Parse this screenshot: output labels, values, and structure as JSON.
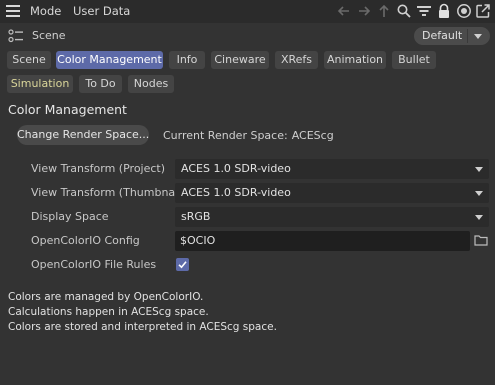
{
  "menubar": {
    "mode_label": "Mode",
    "user_data_label": "User Data",
    "icons": [
      "hamburger-icon",
      "arrow-left-icon",
      "arrow-right-icon",
      "arrow-up-icon",
      "search-icon",
      "filter-icon",
      "lock-icon",
      "target-icon",
      "new-window-icon"
    ]
  },
  "scene": {
    "label": "Scene",
    "preset": "Default"
  },
  "tabs": [
    {
      "label": "Scene"
    },
    {
      "label": "Color Management",
      "active": true
    },
    {
      "label": "Info"
    },
    {
      "label": "Cineware"
    },
    {
      "label": "XRefs"
    },
    {
      "label": "Animation"
    },
    {
      "label": "Bullet"
    },
    {
      "label": "Simulation"
    },
    {
      "label": "To Do"
    },
    {
      "label": "Nodes"
    }
  ],
  "section": {
    "title": "Color Management",
    "change_button": "Change Render Space...",
    "current_render_space_label": "Current Render Space:",
    "current_render_space_value": "ACEScg"
  },
  "properties": {
    "view_transform_project": {
      "label": "View Transform (Project)",
      "value": "ACES 1.0 SDR-video"
    },
    "view_transform_thumbnails": {
      "label": "View Transform (Thumbnails)",
      "value": "ACES 1.0 SDR-video"
    },
    "display_space": {
      "label": "Display Space",
      "value": "sRGB"
    },
    "ocio_config": {
      "label": "OpenColorIO Config",
      "value": "$OCIO"
    },
    "ocio_file_rules": {
      "label": "OpenColorIO File Rules",
      "checked": true
    }
  },
  "info_lines": [
    "Colors are managed by OpenColorIO.",
    "Calculations happen in ACEScg space.",
    "Colors are stored and interpreted in ACEScg space."
  ],
  "colors": {
    "background": "#333333",
    "accent": "#5d6aa8",
    "simulation_tab_text": "#d9d59a"
  }
}
